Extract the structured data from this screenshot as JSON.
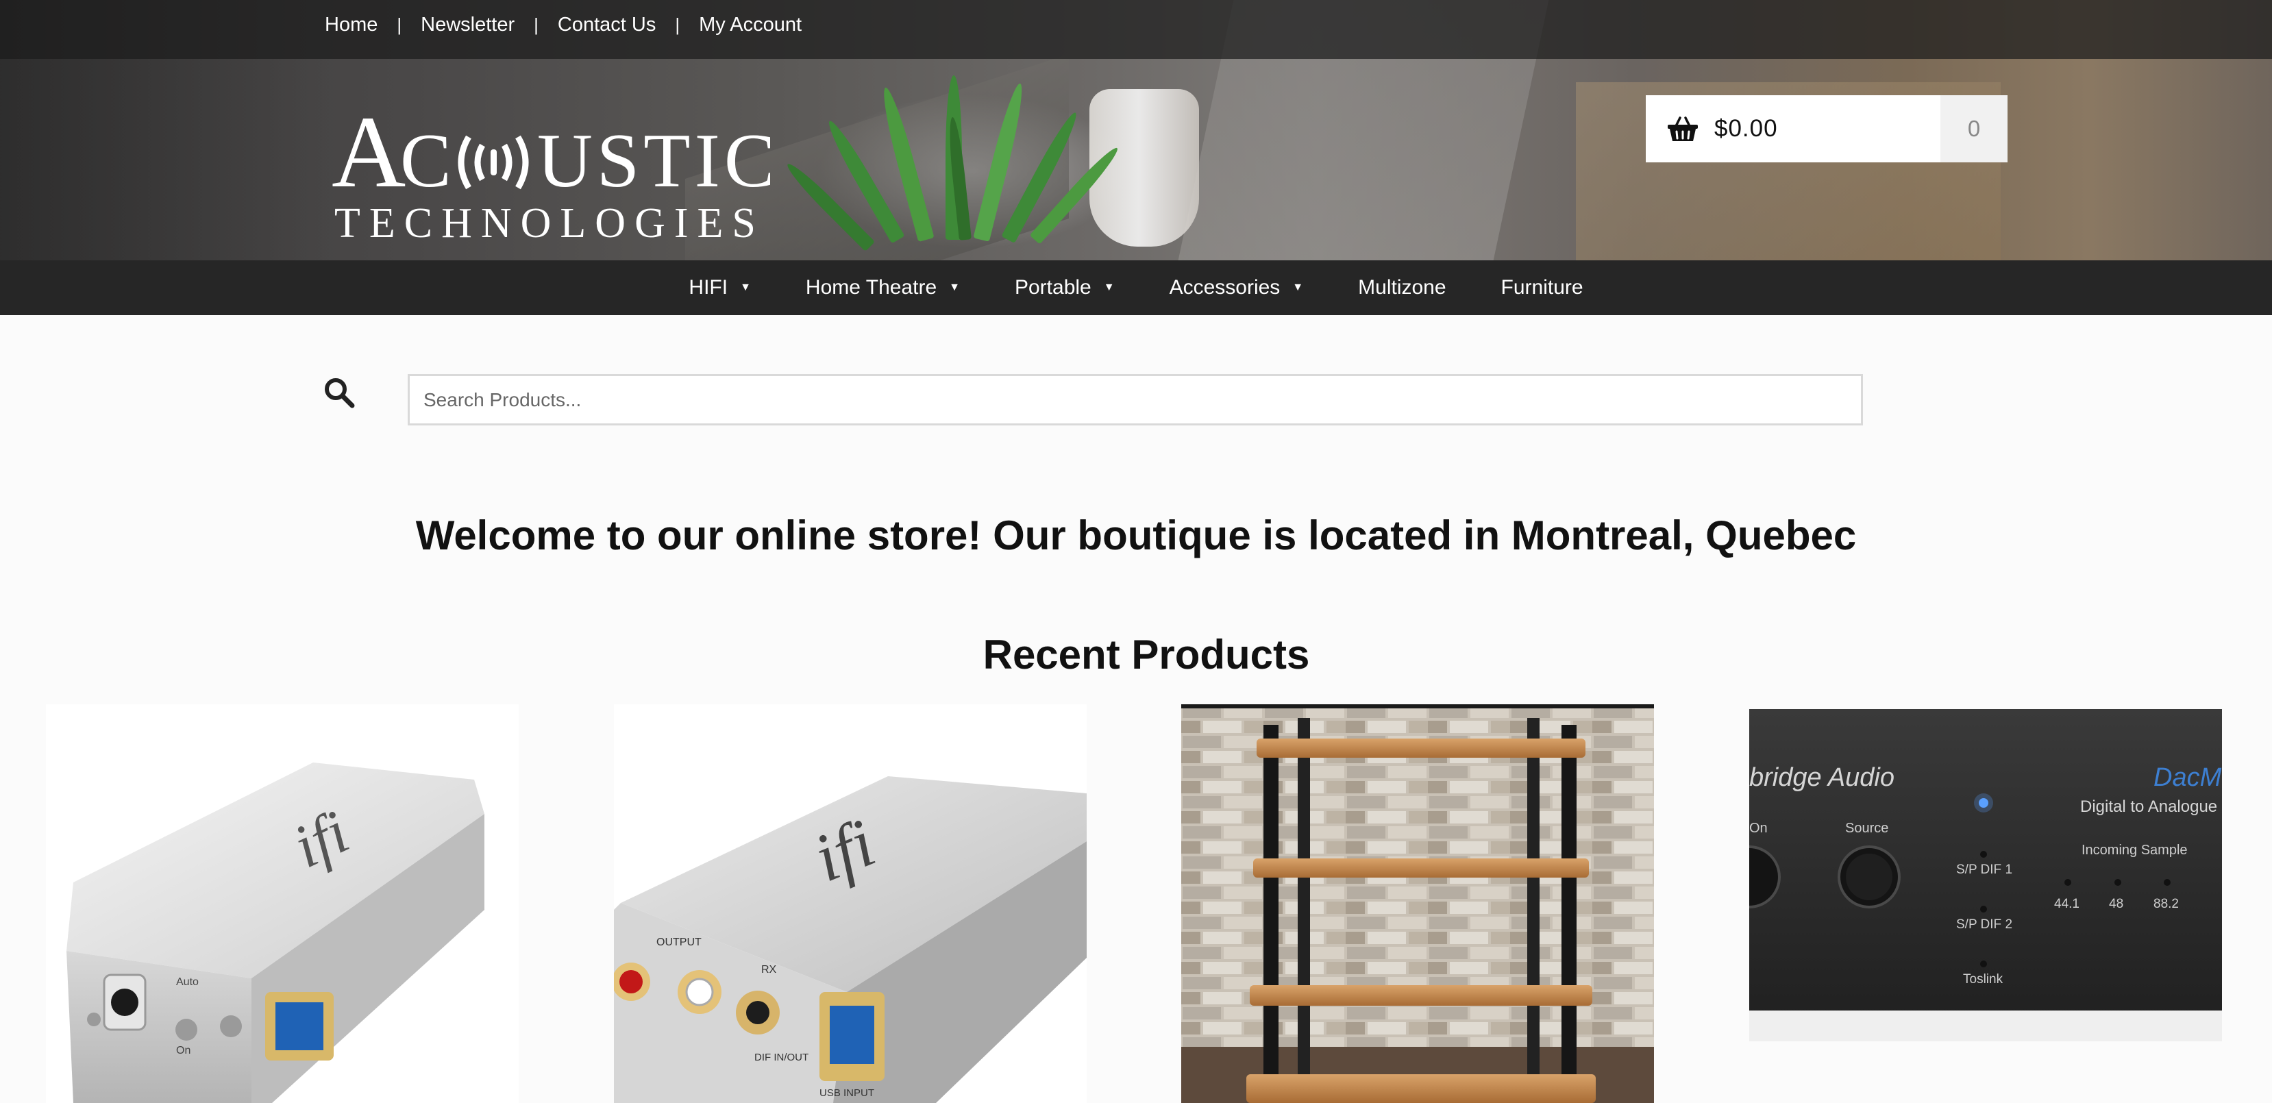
{
  "topnav": {
    "links": [
      "Home",
      "Newsletter",
      "Contact Us",
      "My Account"
    ]
  },
  "logo": {
    "line1": "ACOUSTIC",
    "line2": "TECHNOLOGIES"
  },
  "cart": {
    "total": "$0.00",
    "count": "0",
    "icon": "basket-icon"
  },
  "mainnav": {
    "items": [
      {
        "label": "HIFI",
        "has_dropdown": true
      },
      {
        "label": "Home Theatre",
        "has_dropdown": true
      },
      {
        "label": "Portable",
        "has_dropdown": true
      },
      {
        "label": "Accessories",
        "has_dropdown": true
      },
      {
        "label": "Multizone",
        "has_dropdown": false
      },
      {
        "label": "Furniture",
        "has_dropdown": false
      }
    ]
  },
  "search": {
    "placeholder": "Search Products...",
    "value": "",
    "icon": "search-icon"
  },
  "welcome": "Welcome to our online store! Our boutique is located in Montreal, Quebec",
  "recent_products": {
    "heading": "Recent Products",
    "products": [
      {
        "image": "ifi-usb-power-silver-box",
        "brand_text": "ifi",
        "port_labels": [
          "Auto",
          "On"
        ]
      },
      {
        "image": "ifi-spdif-silver-box",
        "brand_text": "ifi",
        "port_labels": [
          "OUTPUT",
          "RX",
          "DIF IN/OUT",
          "USB INPUT"
        ]
      },
      {
        "image": "bamboo-audio-rack",
        "brand_text": ""
      },
      {
        "image": "cambridge-audio-dacmagic-front",
        "brand_text": "bridge Audio",
        "model_text": "DacMa",
        "subtitle": "Digital to Analogue",
        "control_labels": [
          "On",
          "Source",
          "S/P DIF 1",
          "S/P DIF 2",
          "Toslink",
          "Incoming Sample",
          "44.1",
          "48",
          "88.2"
        ]
      }
    ]
  },
  "colors": {
    "topbar": "#1c1c1c",
    "mainnav": "#262626",
    "page_bg": "#fbfbfb",
    "cart_count_bg": "#f1f1f1"
  }
}
